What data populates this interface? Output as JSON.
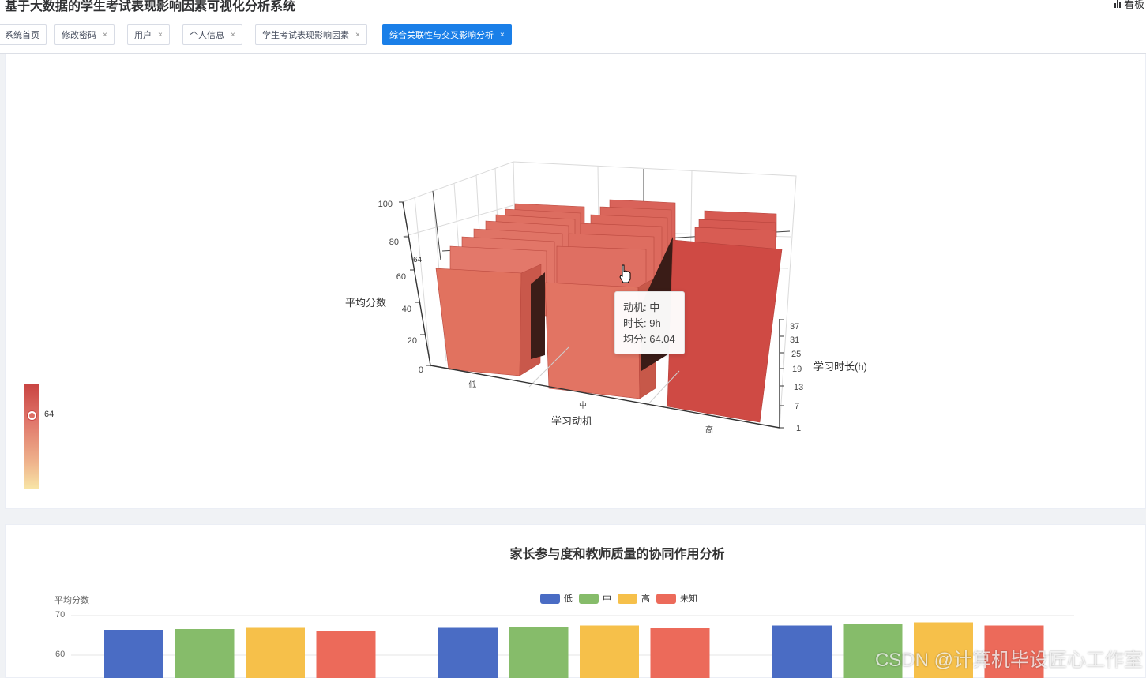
{
  "header": {
    "app_title": "基于大数据的学生考试表现影响因素可视化分析系统",
    "dashboard_label": "看板"
  },
  "tabs": [
    {
      "label": "系统首页",
      "closable": false,
      "active": false
    },
    {
      "label": "修改密码",
      "closable": true,
      "active": false
    },
    {
      "label": "用户",
      "closable": true,
      "active": false
    },
    {
      "label": "个人信息",
      "closable": true,
      "active": false
    },
    {
      "label": "学生考试表现影响因素",
      "closable": true,
      "active": false
    },
    {
      "label": "综合关联性与交叉影响分析",
      "closable": true,
      "active": true
    }
  ],
  "chart3d": {
    "type": "bar3d",
    "x_axis_label": "学习动机",
    "x_categories": [
      "低",
      "中",
      "高"
    ],
    "y_axis_label": "学习时长(h)",
    "y_ticks": [
      "1",
      "7",
      "13",
      "19",
      "25",
      "31",
      "37"
    ],
    "z_axis_label": "平均分数",
    "z_ticks": [
      "0",
      "20",
      "40",
      "60",
      "80",
      "100"
    ],
    "axis_pointer_value": "64",
    "colors": {
      "low": "#f8e6a6",
      "high": "#c94543"
    },
    "tooltip": {
      "line1": "动机: 中",
      "line2": "时长: 9h",
      "line3": "均分: 64.04"
    },
    "visual_map": {
      "current_value": "64"
    }
  },
  "chart2": {
    "title": "家长参与度和教师质量的协同作用分析",
    "ylabel": "平均分数",
    "y_ticks": [
      "70",
      "60"
    ],
    "legend": [
      {
        "name": "低",
        "color": "#4a6cc4"
      },
      {
        "name": "中",
        "color": "#86bc6a"
      },
      {
        "name": "高",
        "color": "#f6c04a"
      },
      {
        "name": "未知",
        "color": "#ec6a5a"
      }
    ]
  },
  "chart_data": {
    "type": "bar",
    "title": "家长参与度和教师质量的协同作用分析",
    "ylabel": "平均分数",
    "ylim": [
      50,
      72
    ],
    "legend": [
      "低",
      "中",
      "高",
      "未知"
    ],
    "groups": [
      {
        "values": [
          66.4,
          66.6,
          66.9,
          66.0
        ]
      },
      {
        "values": [
          66.9,
          67.1,
          67.5,
          66.8
        ]
      },
      {
        "values": [
          67.5,
          67.9,
          68.3,
          67.5
        ]
      }
    ]
  },
  "watermark": "CSDN @计算机毕设匠心工作室"
}
